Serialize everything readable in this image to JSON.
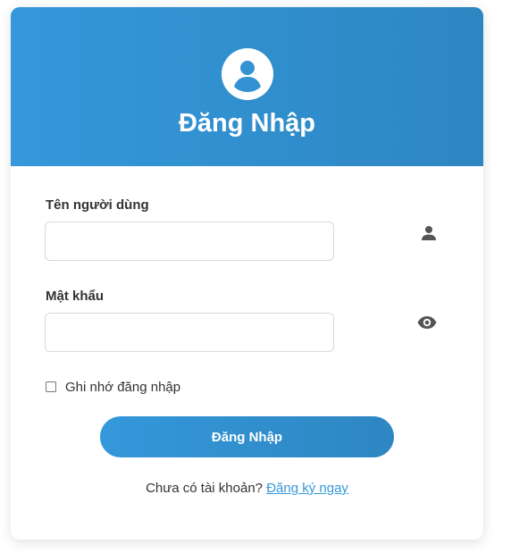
{
  "header": {
    "title": "Đăng Nhập",
    "icon": "user-circle-icon"
  },
  "form": {
    "username": {
      "label": "Tên người dùng",
      "value": "",
      "placeholder": "",
      "icon": "user-icon"
    },
    "password": {
      "label": "Mật khẩu",
      "value": "",
      "placeholder": "",
      "icon": "eye-icon"
    },
    "remember": {
      "label": "Ghi nhớ đăng nhập",
      "checked": false
    },
    "submit_label": "Đăng Nhập"
  },
  "footer": {
    "prompt": "Chưa có tài khoản?",
    "link_label": "Đăng ký ngay"
  },
  "colors": {
    "accent": "#3498db",
    "accent_dark": "#2e86c1",
    "text": "#333333",
    "icon_gray": "#555555"
  }
}
